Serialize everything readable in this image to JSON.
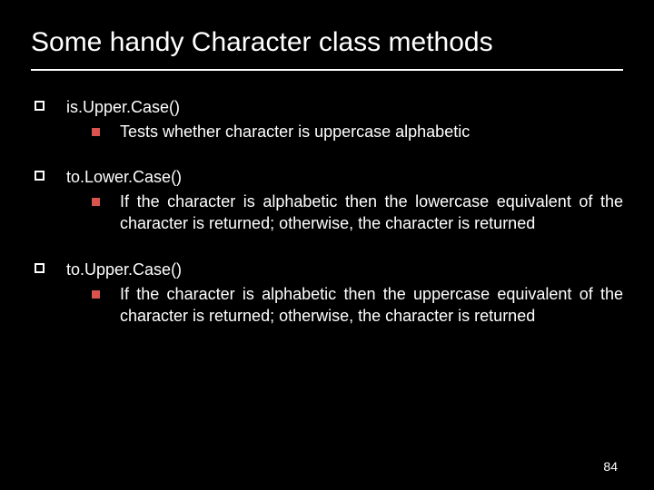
{
  "title": "Some handy Character class methods",
  "items": [
    {
      "method": "is.Upper.Case()",
      "desc": "Tests whether character is uppercase alphabetic",
      "justify": false
    },
    {
      "method": "to.Lower.Case()",
      "desc": "If the character is alphabetic then the lowercase equivalent of the character is returned; otherwise, the character is returned",
      "justify": true
    },
    {
      "method": "to.Upper.Case()",
      "desc": "If the character is alphabetic then the uppercase equivalent of the character is returned; otherwise, the character is returned",
      "justify": true
    }
  ],
  "page_number": "84"
}
